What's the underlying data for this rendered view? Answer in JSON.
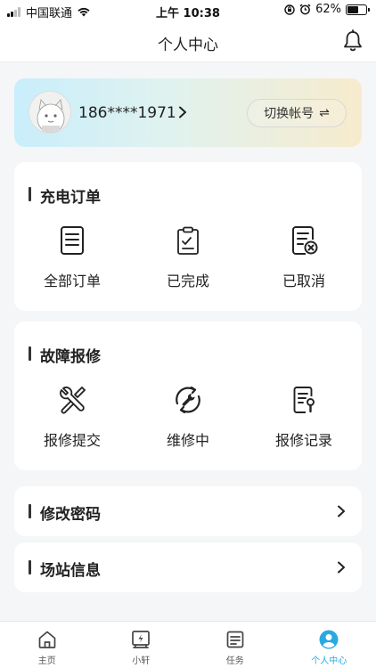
{
  "status_bar": {
    "carrier": "中国联通",
    "time": "上午 10:38",
    "battery_percent": "62%",
    "battery_level": 0.62
  },
  "header": {
    "title": "个人中心",
    "icon": "bell-icon"
  },
  "profile": {
    "phone": "186****1971",
    "switch_label": "切换帐号",
    "switch_icon": "⇌"
  },
  "charging_orders": {
    "title": "充电订单",
    "items": [
      {
        "label": "全部订单",
        "icon": "order-list-icon"
      },
      {
        "label": "已完成",
        "icon": "clipboard-check-icon"
      },
      {
        "label": "已取消",
        "icon": "order-cancel-icon"
      }
    ]
  },
  "repair": {
    "title": "故障报修",
    "items": [
      {
        "label": "报修提交",
        "icon": "tools-icon"
      },
      {
        "label": "维修中",
        "icon": "wrench-cycle-icon"
      },
      {
        "label": "报修记录",
        "icon": "repair-record-icon"
      }
    ]
  },
  "menu": {
    "change_password": "修改密码",
    "station_info": "场站信息"
  },
  "tabbar": {
    "items": [
      {
        "label": "主页",
        "icon": "home-icon"
      },
      {
        "label": "小轩",
        "icon": "charger-icon"
      },
      {
        "label": "任务",
        "icon": "task-icon"
      },
      {
        "label": "个人中心",
        "icon": "profile-icon"
      }
    ],
    "active_color": "#2aa9e0"
  }
}
